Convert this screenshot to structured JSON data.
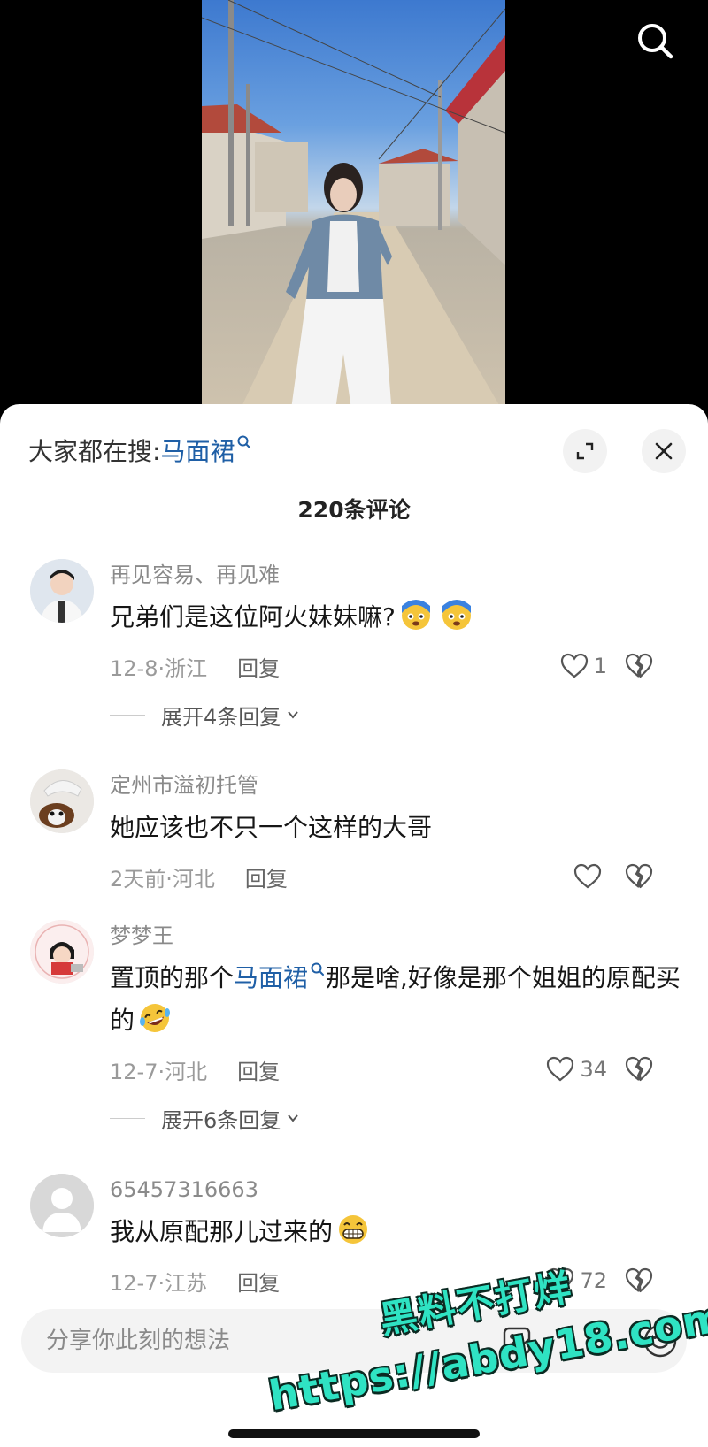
{
  "video": {
    "search_icon": "search-icon"
  },
  "sheet": {
    "trending_prefix": "大家都在搜:",
    "trending_keyword": "马面裙",
    "expand_icon": "expand-icon",
    "close_icon": "close-icon",
    "comment_count": "220条评论"
  },
  "comments": [
    {
      "username": "再见容易、再见难",
      "text": "兄弟们是这位阿火妹妹嘛?",
      "emojis": [
        "worried-face-emoji",
        "worried-face-emoji"
      ],
      "date": "12-8·浙江",
      "reply_label": "回复",
      "likes": "1",
      "expand_label": "展开4条回复"
    },
    {
      "username": "定州市溢初托管",
      "text": "她应该也不只一个这样的大哥",
      "date": "2天前·河北",
      "reply_label": "回复",
      "likes": ""
    },
    {
      "username": "梦梦王",
      "text_before": "置顶的那个",
      "keyword": "马面裙",
      "text_after": "那是啥,好像是那个姐姐的原配买的",
      "emojis": [
        "rolling-laughing-emoji"
      ],
      "date": "12-7·河北",
      "reply_label": "回复",
      "likes": "34",
      "expand_label": "展开6条回复"
    },
    {
      "username": "65457316663",
      "text": "我从原配那儿过来的",
      "emojis": [
        "grinning-emoji"
      ],
      "date": "12-7·江苏",
      "reply_label": "回复",
      "likes": "72"
    }
  ],
  "input": {
    "placeholder": "分享你此刻的想法"
  },
  "watermark": {
    "line1": "黑料不打烊",
    "line2": "https://abdy18.com"
  },
  "colors": {
    "keyword": "#1f5fa6",
    "watermark": "#2fe3c3"
  }
}
